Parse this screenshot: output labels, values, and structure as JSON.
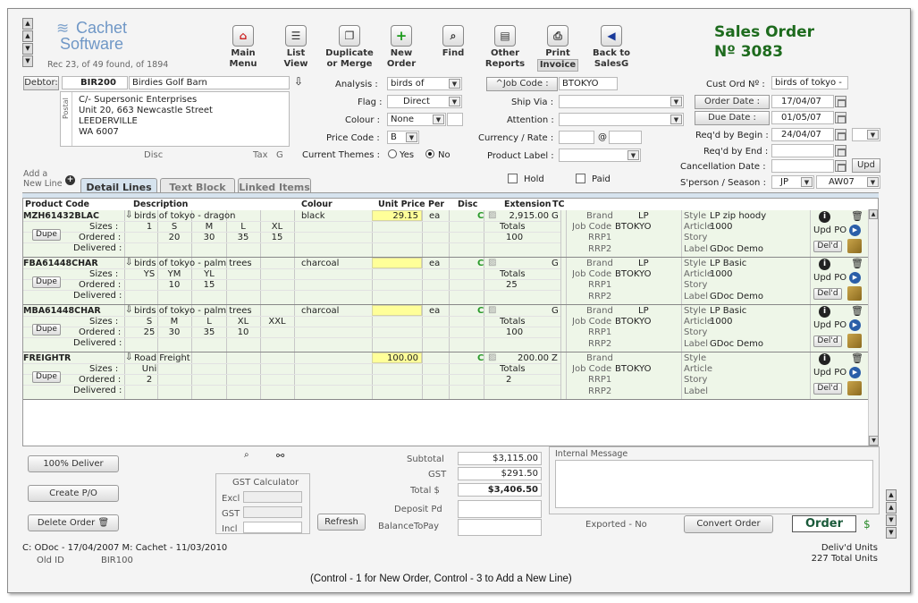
{
  "header": {
    "logo_line1": "Cachet",
    "logo_line2": "Software",
    "rec_info": "Rec 23, of 49 found, of 1894",
    "title": "Sales Order",
    "order_no": "Nº 3083"
  },
  "toolbar": {
    "main_menu": "Main\nMenu",
    "list_view": "List\nView",
    "duplicate": "Duplicate\nor Merge",
    "new_order": "New\nOrder",
    "find": "Find",
    "other_reports": "Other\nReports",
    "print": "Print",
    "invoice": "Invoice",
    "back": "Back to\nSalesG"
  },
  "debtor": {
    "label": "Debtor:",
    "code": "BIR200",
    "name": "Birdies Golf Barn",
    "postal_label": "Postal",
    "address1": "C/- Supersonic Enterprises",
    "address2": "Unit 20, 663 Newcastle Street",
    "address3": "LEEDERVILLE",
    "address4": "WA  6007",
    "disc_label": "Disc",
    "tax_label": "Tax",
    "tax_value": "G"
  },
  "mid_fields": {
    "analysis_label": "Analysis :",
    "analysis_value": "birds of",
    "flag_label": "Flag :",
    "flag_value": "Direct",
    "colour_label": "Colour :",
    "colour_value": "None",
    "price_code_label": "Price Code :",
    "price_code_value": "B",
    "themes_label": "Current Themes :",
    "themes_yes": "Yes",
    "themes_no": "No"
  },
  "right_fields": {
    "job_code_label": "^Job Code :",
    "job_code_value": "BTOKYO",
    "ship_via_label": "Ship Via :",
    "attention_label": "Attention :",
    "currency_label": "Currency / Rate :",
    "at": "@",
    "product_label_label": "Product Label :",
    "hold_label": "Hold",
    "paid_label": "Paid"
  },
  "far_right": {
    "cust_ord_label": "Cust Ord Nº :",
    "cust_ord_value": "birds of tokyo -",
    "order_date_label": "Order Date :",
    "order_date_value": "17/04/07",
    "due_date_label": "Due Date :",
    "due_date_value": "01/05/07",
    "reqd_begin_label": "Req'd by Begin :",
    "reqd_begin_value": "24/04/07",
    "reqd_end_label": "Req'd by End :",
    "cancel_label": "Cancellation Date :",
    "upd": "Upd",
    "sperson_label": "S'person / Season :",
    "sperson_value": "JP",
    "season_value": "AW07"
  },
  "tabs": {
    "add_line": "Add a\nNew Line",
    "detail": "Detail Lines",
    "text_block": "Text Block",
    "linked": "Linked Items"
  },
  "grid_headers": {
    "product_code": "Product Code",
    "description": "Description",
    "colour": "Colour",
    "unit_price": "Unit Price",
    "per": "Per",
    "disc": "Disc",
    "extension": "Extension",
    "tc": "TC"
  },
  "row_labels": {
    "sizes": "Sizes :",
    "ordered": "Ordered :",
    "delivered": "Delivered :",
    "dupe": "Dupe",
    "totals": "Totals",
    "brand": "Brand",
    "job_code": "Job Code",
    "rrp1": "RRP1",
    "rrp2": "RRP2",
    "style": "Style",
    "article": "Article",
    "story": "Story",
    "label": "Label",
    "upd_po": "Upd PO",
    "deld": "Del'd"
  },
  "lines": [
    {
      "code": "MZH61432BLAC",
      "desc": "birds of tokyo - dragon",
      "colour": "black",
      "price": "29.15",
      "per": "ea",
      "disc": "C",
      "ext": "2,915.00",
      "tc": "G",
      "sizes": [
        "1",
        "S",
        "M",
        "L",
        "XL"
      ],
      "ordered": [
        "",
        "20",
        "30",
        "35",
        "15"
      ],
      "total": "100",
      "brand": "LP",
      "job": "BTOKYO",
      "style": "LP zip hoody",
      "article": "1000",
      "label_val": "GDoc Demo"
    },
    {
      "code": "FBA61448CHAR",
      "desc": "birds of tokyo - palm trees",
      "colour": "charcoal",
      "price": "",
      "per": "ea",
      "disc": "C",
      "ext": "",
      "tc": "G",
      "sizes": [
        "YS",
        "YM",
        "YL",
        "",
        ""
      ],
      "ordered": [
        "",
        "10",
        "15",
        "",
        ""
      ],
      "total": "25",
      "brand": "LP",
      "job": "BTOKYO",
      "style": "LP Basic",
      "article": "1000",
      "label_val": "GDoc Demo"
    },
    {
      "code": "MBA61448CHAR",
      "desc": "birds of tokyo - palm trees",
      "colour": "charcoal",
      "price": "",
      "per": "ea",
      "disc": "C",
      "ext": "",
      "tc": "G",
      "sizes": [
        "S",
        "M",
        "L",
        "XL",
        "XXL"
      ],
      "ordered": [
        "25",
        "30",
        "35",
        "10",
        ""
      ],
      "total": "100",
      "brand": "LP",
      "job": "BTOKYO",
      "style": "LP Basic",
      "article": "1000",
      "label_val": "GDoc Demo"
    },
    {
      "code": "FREIGHTR",
      "desc": "Road Freight",
      "colour": "",
      "price": "100.00",
      "per": "",
      "disc": "C",
      "ext": "200.00",
      "tc": "Z",
      "sizes": [
        "Uni",
        "",
        "",
        "",
        ""
      ],
      "ordered": [
        "2",
        "",
        "",
        "",
        ""
      ],
      "total": "2",
      "brand": "",
      "job": "BTOKYO",
      "style": "",
      "article": "",
      "label_val": ""
    }
  ],
  "bottom": {
    "deliver_btn": "100% Deliver",
    "create_po_btn": "Create P/O",
    "delete_btn": "Delete Order",
    "gst_calc_title": "GST Calculator",
    "excl": "Excl",
    "gst": "GST",
    "incl": "Incl",
    "refresh_btn": "Refresh",
    "subtotal_label": "Subtotal",
    "subtotal_value": "$3,115.00",
    "gst_label": "GST",
    "gst_value": "$291.50",
    "total_label": "Total  $",
    "total_value": "$3,406.50",
    "deposit_label": "Deposit Pd",
    "balance_label": "BalanceToPay",
    "internal_msg_label": "Internal Message",
    "exported": "Exported - No",
    "convert_btn": "Convert Order",
    "order_btn": "Order"
  },
  "footer": {
    "created": "C: ODoc - 17/04/2007 M: Cachet - 11/03/2010",
    "old_id_label": "Old ID",
    "old_id_value": "BIR100",
    "delivd_units": "Deliv'd Units",
    "total_units": "227 Total Units",
    "hint": "(Control - 1 for New Order, Control - 3 to Add a New Line)"
  },
  "colors": {
    "title_green": "#1e6b1e",
    "highlight_yellow": "#ffff99",
    "row_green": "#eef6e8"
  }
}
